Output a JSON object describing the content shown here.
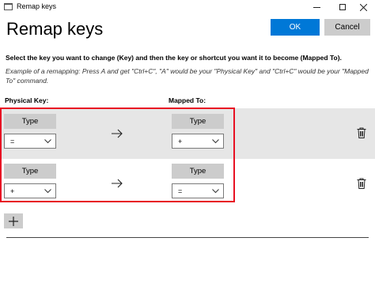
{
  "window": {
    "title": "Remap keys"
  },
  "header": {
    "title": "Remap keys",
    "ok_label": "OK",
    "cancel_label": "Cancel"
  },
  "instructions": {
    "main": "Select the key you want to change (Key) and then the key or shortcut you want it to become (Mapped To).",
    "example": "Example of a remapping: Press A and get \"Ctrl+C\", \"A\" would be your \"Physical Key\" and \"Ctrl+C\" would be your \"Mapped To\" command."
  },
  "columns": {
    "physical": "Physical Key:",
    "mapped": "Mapped To:"
  },
  "rows": [
    {
      "physical_type_label": "Type",
      "physical_value": "=",
      "mapped_type_label": "Type",
      "mapped_value": "+"
    },
    {
      "physical_type_label": "Type",
      "physical_value": "+",
      "mapped_type_label": "Type",
      "mapped_value": "="
    }
  ],
  "icons": {
    "app": "keyboard-icon",
    "arrow": "arrow-right-icon",
    "delete": "trash-icon",
    "add": "plus-icon",
    "dropdown": "chevron-down-icon"
  },
  "colors": {
    "accent": "#0078d7",
    "highlight_border": "#e81123",
    "row_alt": "#e6e6e6",
    "button_gray": "#cccccc"
  }
}
